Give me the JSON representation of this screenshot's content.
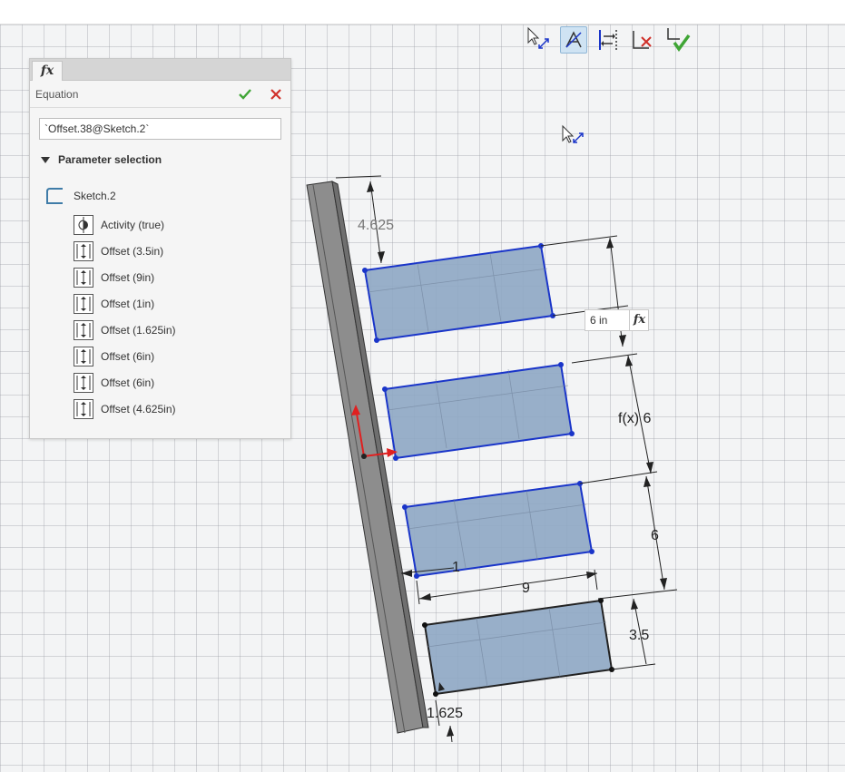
{
  "equation_panel": {
    "tab_label": "fx",
    "title": "Equation",
    "expression_value": "`Offset.38@Sketch.2`",
    "section_title": "Parameter selection",
    "sketch_name": "Sketch.2",
    "parameters": [
      {
        "label": "Activity (true)",
        "icon": "activity-icon"
      },
      {
        "label": "Offset (3.5in)",
        "icon": "offset-icon"
      },
      {
        "label": "Offset (9in)",
        "icon": "offset-icon"
      },
      {
        "label": "Offset (1in)",
        "icon": "offset-icon"
      },
      {
        "label": "Offset (1.625in)",
        "icon": "offset-icon"
      },
      {
        "label": "Offset (6in)",
        "icon": "offset-icon"
      },
      {
        "label": "Offset (6in)",
        "icon": "offset-icon"
      },
      {
        "label": "Offset (4.625in)",
        "icon": "offset-icon"
      }
    ]
  },
  "toolbar": {
    "tools": [
      "select-cursor-icon",
      "snap-filter-icon",
      "offset-direction-icon",
      "cancel-sketch-icon",
      "exit-sketch-icon"
    ]
  },
  "dimension_editor": {
    "value": "6 in",
    "fx_label": "fx"
  },
  "dimensions": {
    "top_offset": "4.625",
    "f6": "f(x) 6",
    "six": "6",
    "one": "1",
    "nine": "9",
    "three_five": "3.5",
    "one_625": "1.625"
  },
  "colors": {
    "accent_blue": "#1a35c9",
    "rect_fill": "#8ea7c4",
    "ok_green": "#3fa535",
    "cancel_red": "#d0302a",
    "axis_red": "#e02020"
  }
}
